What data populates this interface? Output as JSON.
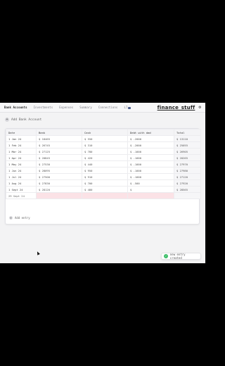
{
  "nav": {
    "tabs": [
      "Bank Accounts",
      "Investments",
      "Expenses",
      "Summary",
      "Connections"
    ],
    "lang": "LT",
    "brand": "finance_stuff"
  },
  "add_account_label": "Add Bank Account",
  "table": {
    "headers": [
      "Date",
      "Bank",
      "Cash",
      "Debt with dad",
      "Total"
    ],
    "rows": [
      [
        "1 Jan 24",
        "$ 18465",
        "$ 550",
        "$ -2000",
        "$ 13110"
      ],
      [
        "1 Feb 24",
        "$ 26745",
        "$ 310",
        "$ -2000",
        "$ 25055"
      ],
      [
        "1 Mar 24",
        "$ 27125",
        "$ 780",
        "$ -1000",
        "$ 26905"
      ],
      [
        "1 Apr 24",
        "$ 20845",
        "$ 420",
        "$ -1000",
        "$ 20265"
      ],
      [
        "1 May 24",
        "$ 27530",
        "$ 440",
        "$ -1000",
        "$ 27970"
      ],
      [
        "1 Jun 24",
        "$ 28095",
        "$ 950",
        "$ -1000",
        "$ 27980"
      ],
      [
        "1 Jul 24",
        "$ 27500",
        "$ 910",
        "$ -1000",
        "$ 27120"
      ],
      [
        "1 Aug 24",
        "$ 27830",
        "$ 700",
        "$ -500",
        "$ 27920"
      ],
      [
        "1 Sept 24",
        "$ 28120",
        "$ 480",
        "$",
        "$ 28565"
      ]
    ],
    "new_row_date": "29 Sept 24"
  },
  "add_entry_label": "Add entry",
  "toast": {
    "text": "new entry created"
  },
  "colors": {
    "accent": "#3fbf6a",
    "new_row": "#fbe2e6"
  }
}
